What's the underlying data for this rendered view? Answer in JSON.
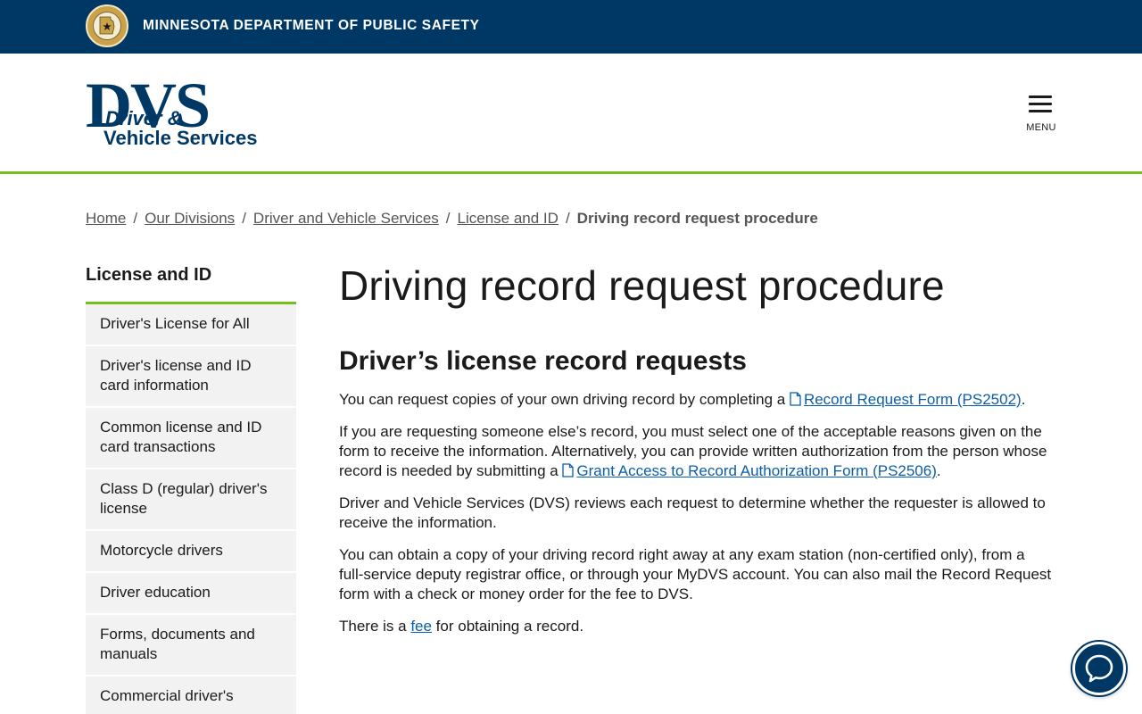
{
  "topbar": {
    "agency_name": "MINNESOTA DEPARTMENT OF PUBLIC SAFETY",
    "seal_icon": "minnesota-state-seal"
  },
  "header": {
    "logo": {
      "big": "DVS",
      "line1": "Driver &",
      "line2": "Vehicle Services"
    },
    "menu_label": "MENU"
  },
  "breadcrumb": {
    "items": [
      "Home",
      "Our Divisions",
      "Driver and Vehicle Services",
      "License and ID"
    ],
    "current": "Driving record request procedure"
  },
  "sidebar": {
    "title": "License and ID",
    "items": [
      {
        "label": "Driver's License for All"
      },
      {
        "label": "Driver's license and ID card information"
      },
      {
        "label": "Common license and ID card transactions"
      },
      {
        "label": "Class D (regular) driver's license"
      },
      {
        "label": "Motorcycle drivers"
      },
      {
        "label": "Driver education"
      },
      {
        "label": "Forms, documents and manuals"
      },
      {
        "label": "Commercial driver's"
      }
    ]
  },
  "main": {
    "title": "Driving record request procedure",
    "section_title": "Driver’s license record requests",
    "p1": {
      "before": "You can request copies of your own driving record by completing a ",
      "link": "Record Request Form (PS2502)",
      "after": "."
    },
    "p2": {
      "before": "If you are requesting someone else’s record,  you must select one of the acceptable reasons given on the form to receive the information.  Alternatively, you can provide written authorization from the person whose record is needed by submitting a ",
      "link": "Grant Access to Record Authorization Form (PS2506)",
      "after": "."
    },
    "p3": "Driver and Vehicle Services (DVS) reviews each request to determine whether the requester is allowed to receive the information.",
    "p4": "You can obtain a copy of your driving record right away at any exam station (non-certified only), from a full-service deputy registrar office, or through your MyDVS account.  You can also mail the Record Request form with a check or money order for the fee to DVS.",
    "p5": {
      "before": "There is a ",
      "link": "fee",
      "after": " for obtaining a record."
    }
  },
  "icons": {
    "document": "document-icon",
    "chat": "chat-bubble-icon",
    "menu": "hamburger-menu-icon"
  },
  "colors": {
    "navy": "#003865",
    "accent_green": "#78be20",
    "link_blue": "#0b5ea8",
    "sidebar_bg": "#f2f2f2"
  }
}
